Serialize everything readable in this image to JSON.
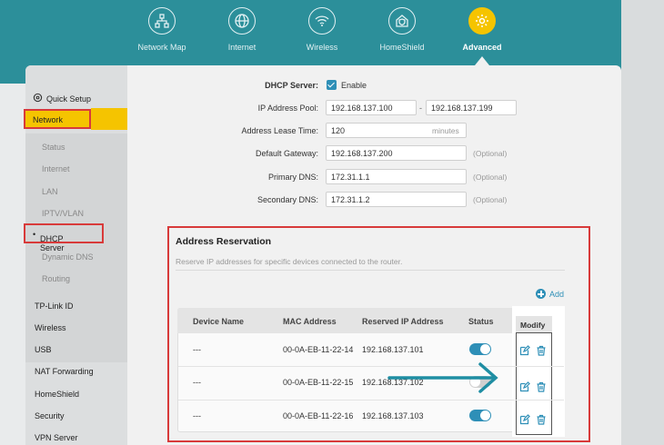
{
  "nav": {
    "items": [
      {
        "label": "Network Map",
        "icon": "network-map-icon"
      },
      {
        "label": "Internet",
        "icon": "globe-icon"
      },
      {
        "label": "Wireless",
        "icon": "wifi-icon"
      },
      {
        "label": "HomeShield",
        "icon": "home-shield-icon"
      },
      {
        "label": "Advanced",
        "icon": "gear-icon",
        "active": true
      }
    ]
  },
  "sidebar": {
    "quick_setup": "Quick Setup",
    "network": "Network",
    "network_sub": [
      "Status",
      "Internet",
      "LAN",
      "IPTV/VLAN",
      "DHCP Server",
      "Dynamic DNS",
      "Routing"
    ],
    "items": [
      "TP-Link ID",
      "Wireless",
      "USB",
      "NAT Forwarding",
      "HomeShield",
      "Security",
      "VPN Server"
    ]
  },
  "dhcp": {
    "server_label": "DHCP Server:",
    "enable_label": "Enable",
    "pool_label": "IP Address Pool:",
    "pool_start": "192.168.137.100",
    "pool_end": "192.168.137.199",
    "pool_dash": "-",
    "lease_label": "Address Lease Time:",
    "lease_value": "120",
    "lease_unit": "minutes",
    "gateway_label": "Default Gateway:",
    "gateway_value": "192.168.137.200",
    "primary_dns_label": "Primary DNS:",
    "primary_dns_value": "172.31.1.1",
    "secondary_dns_label": "Secondary DNS:",
    "secondary_dns_value": "172.31.1.2",
    "optional": "(Optional)"
  },
  "reservation": {
    "title": "Address Reservation",
    "description": "Reserve IP addresses for specific devices connected to the router.",
    "add_label": "Add",
    "columns": [
      "Device Name",
      "MAC Address",
      "Reserved IP Address",
      "Status",
      "Modify"
    ],
    "rows": [
      {
        "device": "---",
        "mac": "00-0A-EB-11-22-14",
        "ip": "192.168.137.101",
        "enabled": true
      },
      {
        "device": "---",
        "mac": "00-0A-EB-11-22-15",
        "ip": "192.168.137.102",
        "enabled": false
      },
      {
        "device": "---",
        "mac": "00-0A-EB-11-22-16",
        "ip": "192.168.137.103",
        "enabled": true
      }
    ]
  },
  "colors": {
    "header": "#2c8f9a",
    "accent": "#f5c400",
    "highlight_border": "#d83a3a",
    "link": "#2e8fb7",
    "arrow": "#1f8ea3"
  }
}
